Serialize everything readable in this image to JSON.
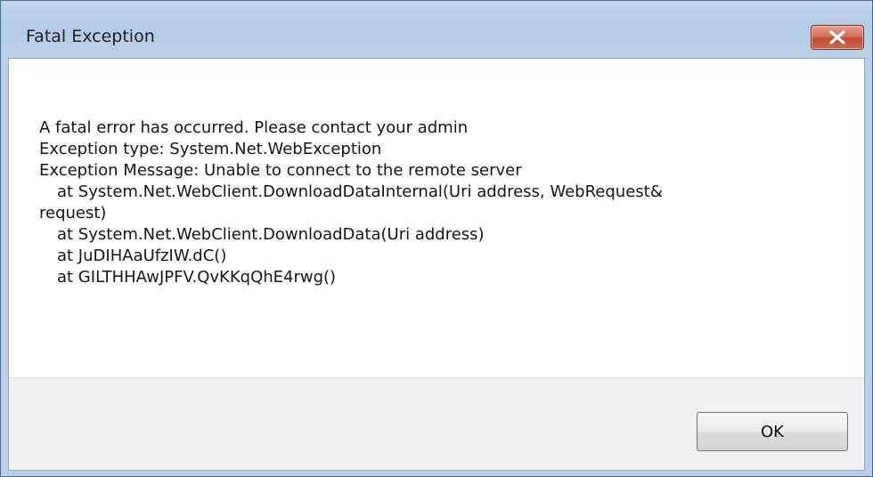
{
  "window": {
    "title": "Fatal Exception",
    "close_icon": "close-x-icon"
  },
  "message": {
    "lines": [
      "A fatal error has occurred.  Please contact your admin",
      "Exception type: System.Net.WebException",
      "Exception Message: Unable to connect to the remote server",
      "at System.Net.WebClient.DownloadDataInternal(Uri address, WebRequest&",
      "request)",
      "at System.Net.WebClient.DownloadData(Uri address)",
      "at JuDIHAaUfzIW.dC()",
      "at GILTHHAwJPFV.QvKKqQhE4rwg()"
    ]
  },
  "buttons": {
    "ok_label": "OK"
  },
  "colors": {
    "titlebar": "#b9d0e8",
    "close_button": "#c94f38",
    "footer": "#f0f0f0"
  }
}
